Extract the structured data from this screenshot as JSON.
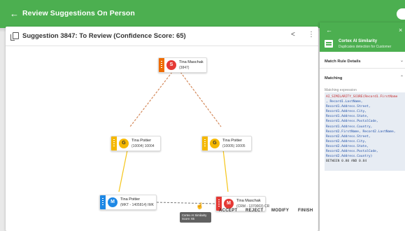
{
  "topbar": {
    "back_icon": "arrow-left-icon",
    "title": "Review Suggestions On Person"
  },
  "card": {
    "title": "Suggestion 3847: To Review (Confidence Score: 65)",
    "share_icon": "share-icon",
    "more_icon": "more-vertical-icon",
    "nodes": {
      "top": {
        "initial": "S",
        "name": "Tina Maschak",
        "id": "(3847)"
      },
      "left_mid": {
        "initial": "G",
        "name": "Tina Poitier",
        "id": "(10004) 10004"
      },
      "right_mid": {
        "initial": "G",
        "name": "Tina Poitier",
        "id": "(10005) 10005"
      },
      "left_bottom": {
        "initial": "M",
        "name": "Tina Poitier",
        "id": "(MKT - 1405814) IMK"
      },
      "right_bottom": {
        "initial": "M",
        "name": "Tina Maschak",
        "id": "(CRM - 1370003) CR"
      }
    },
    "tooltip": {
      "line1": "Cortex AI Similarity",
      "line2": "Score: 65"
    },
    "actions": {
      "accept": "ACCEPT",
      "reject": "REJECT",
      "modify": "MODIFY",
      "finish": "FINISH"
    }
  },
  "panel": {
    "title": "Cortex AI Similarity",
    "subtitle": "Duplicates detection for Customer",
    "sections": {
      "match_rule": "Match Rule Details",
      "matching": "Matching"
    },
    "expression_label": "Matching expression",
    "expression_lines": [
      "AI_SIMILARITY_SCORE(Record1.FirstName",
      ", Record1.LastName,",
      "Record1.Address.Street,",
      "Record1.Address.City,",
      "Record1.Address.State,",
      "Record1.Address.PostalCode,",
      "Record1.Address.Country,",
      "Record2.FirstName, Record2.LastName,",
      "Record2.Address.Street,",
      "Record2.Address.City,",
      "Record2.Address.State,",
      "Record2.Address.PostalCode,",
      "Record2.Address.Country)",
      "BETWEEN 0.80 AND 0.84"
    ]
  },
  "colors": {
    "brand_green": "#4caf50",
    "golden": "#f5b800",
    "source_red": "#e53935",
    "source_blue": "#1e88e5",
    "staging_orange": "#ef6c00"
  }
}
